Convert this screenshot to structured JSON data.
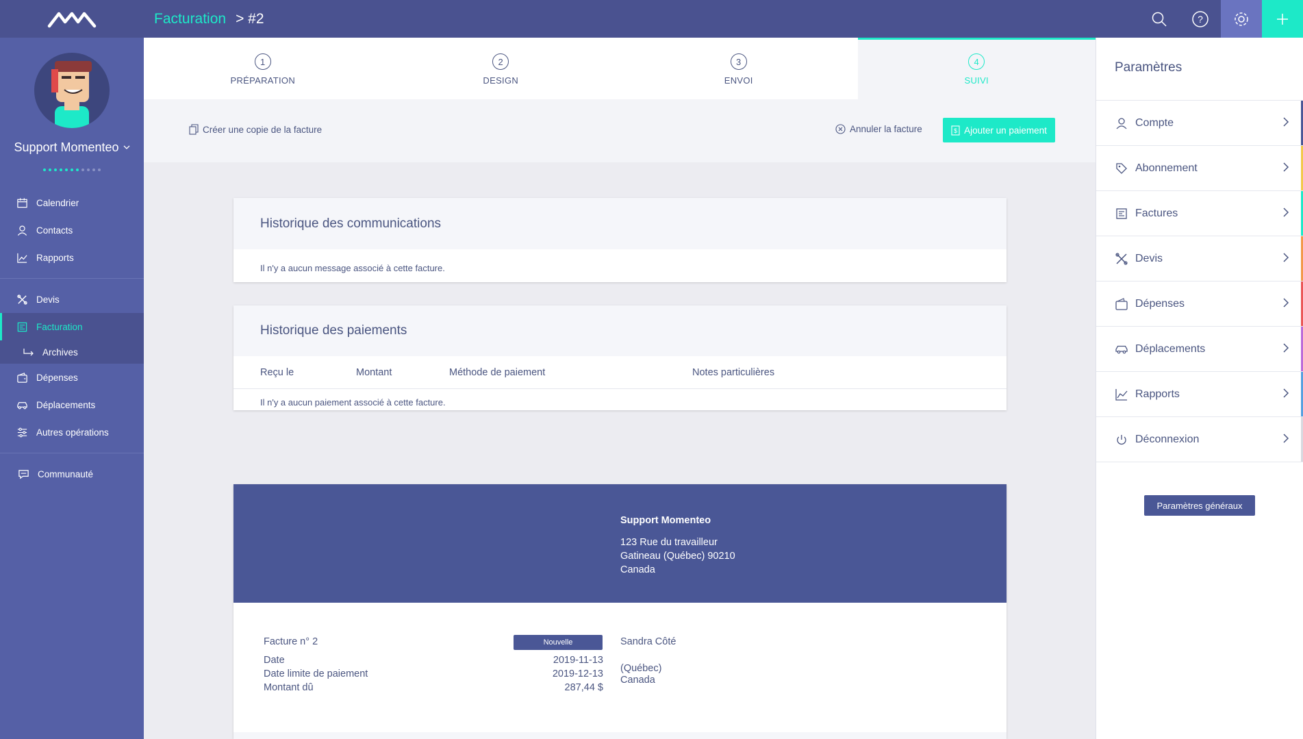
{
  "app": {
    "logo": "momenteo-logo"
  },
  "user": {
    "name": "Support Momenteo"
  },
  "header": {
    "breadcrumb_section": "Facturation",
    "breadcrumb_separator": ">",
    "breadcrumb_current": "#2",
    "icons": [
      "search-icon",
      "help-icon",
      "gear-icon",
      "plus-icon"
    ]
  },
  "sidebar": {
    "group1": [
      {
        "label": "Calendrier",
        "icon": "calendar-icon"
      },
      {
        "label": "Contacts",
        "icon": "user-icon"
      },
      {
        "label": "Rapports",
        "icon": "chart-icon"
      }
    ],
    "group2": [
      {
        "label": "Devis",
        "icon": "tools-icon"
      },
      {
        "label": "Facturation",
        "icon": "invoice-icon",
        "active": true
      },
      {
        "label": "Archives",
        "icon": "sub-arrow-icon"
      },
      {
        "label": "Dépenses",
        "icon": "wallet-icon"
      },
      {
        "label": "Déplacements",
        "icon": "car-icon"
      },
      {
        "label": "Autres opérations",
        "icon": "sliders-icon"
      }
    ],
    "group3": [
      {
        "label": "Communauté",
        "icon": "chat-icon"
      }
    ]
  },
  "stepper": [
    {
      "num": "1",
      "label": "PRÉPARATION"
    },
    {
      "num": "2",
      "label": "DESIGN"
    },
    {
      "num": "3",
      "label": "ENVOI"
    },
    {
      "num": "4",
      "label": "SUIVI",
      "active": true
    }
  ],
  "actions": {
    "copy": "Créer une copie de la facture",
    "cancel": "Annuler la facture",
    "add_payment": "Ajouter un paiement"
  },
  "communications": {
    "title": "Historique des communications",
    "empty": "Il n'y a aucun message associé à cette facture."
  },
  "payments": {
    "title": "Historique des paiements",
    "columns": [
      "Reçu le",
      "Montant",
      "Méthode de paiement",
      "Notes particulières"
    ],
    "empty": "Il n'y a aucun paiement associé à cette facture."
  },
  "invoice": {
    "company_name": "Support Momenteo",
    "address_line1": "123 Rue du travailleur",
    "address_line2": "Gatineau (Québec) 90210",
    "address_line3": "Canada",
    "number_label": "Facture n° 2",
    "status": "Nouvelle",
    "date_label": "Date",
    "date_value": "2019-11-13",
    "due_label": "Date limite de paiement",
    "due_value": "2019-12-13",
    "amount_label": "Montant dû",
    "amount_value": "287,44 $",
    "client_name": "Sandra Côté",
    "client_line1": "(Québec)",
    "client_line2": "Canada"
  },
  "settings_panel": {
    "title": "Paramètres",
    "items": [
      {
        "label": "Compte",
        "icon": "user-icon",
        "color": "#4a5796"
      },
      {
        "label": "Abonnement",
        "icon": "tag-icon",
        "color": "#f2c94c"
      },
      {
        "label": "Factures",
        "icon": "invoice-icon",
        "color": "#1de9c8"
      },
      {
        "label": "Devis",
        "icon": "tools-icon",
        "color": "#f2994a"
      },
      {
        "label": "Dépenses",
        "icon": "wallet-icon",
        "color": "#eb5757"
      },
      {
        "label": "Déplacements",
        "icon": "car-icon",
        "color": "#bb6bd9"
      },
      {
        "label": "Rapports",
        "icon": "chart-icon",
        "color": "#56a0e0"
      },
      {
        "label": "Déconnexion",
        "icon": "power-icon",
        "color": "#d9d9e0"
      }
    ],
    "general_button": "Paramètres généraux"
  },
  "colors": {
    "accent": "#1de9c8",
    "primary": "#4a5290",
    "sidebar": "#5560a6"
  }
}
